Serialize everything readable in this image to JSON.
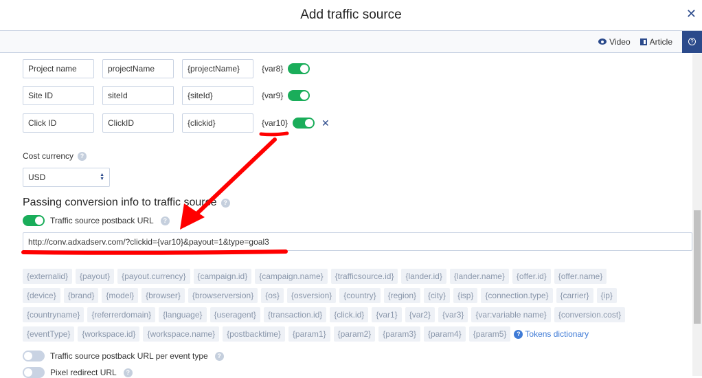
{
  "header": {
    "title": "Add traffic source",
    "close_icon": "close-icon"
  },
  "helpbar": {
    "video": "Video",
    "article": "Article"
  },
  "variables": [
    {
      "name": "Project name",
      "param": "projectName",
      "token": "{projectName}",
      "var": "{var8}",
      "enabled": true
    },
    {
      "name": "Site ID",
      "param": "siteId",
      "token": "{siteId}",
      "var": "{var9}",
      "enabled": true
    },
    {
      "name": "Click ID",
      "param": "ClickID",
      "token": "{clickid}",
      "var": "{var10}",
      "enabled": true
    }
  ],
  "cost_currency": {
    "label": "Cost currency",
    "value": "USD"
  },
  "conversion": {
    "heading": "Passing conversion info to traffic source",
    "postback_label": "Traffic source postback URL",
    "postback_enabled": true,
    "postback_url": "http://conv.adxadserv.com/?clickid={var10}&payout=1&type=goal3",
    "token_rows": [
      [
        "{externalid}",
        "{payout}",
        "{payout.currency}",
        "{campaign.id}",
        "{campaign.name}",
        "{trafficsource.id}",
        "{lander.id}",
        "{lander.name}",
        "{offer.id}",
        "{offer.name}"
      ],
      [
        "{device}",
        "{brand}",
        "{model}",
        "{browser}",
        "{browserversion}",
        "{os}",
        "{osversion}",
        "{country}",
        "{region}",
        "{city}",
        "{isp}",
        "{connection.type}",
        "{carrier}",
        "{ip}"
      ],
      [
        "{countryname}",
        "{referrerdomain}",
        "{language}",
        "{useragent}",
        "{transaction.id}",
        "{click.id}",
        "{var1}",
        "{var2}",
        "{var3}",
        "{var:variable name}",
        "{conversion.cost}"
      ],
      [
        "{eventType}",
        "{workspace.id}",
        "{workspace.name}",
        "{postbacktime}",
        "{param1}",
        "{param2}",
        "{param3}",
        "{param4}",
        "{param5}"
      ]
    ],
    "tokens_dictionary": "Tokens dictionary",
    "per_event_label": "Traffic source postback URL per event type",
    "per_event_enabled": false,
    "pixel_label": "Pixel redirect URL",
    "pixel_enabled": false
  },
  "colors": {
    "accent": "#2b4a8b",
    "toggle_on": "#1aad5a",
    "annotation": "#ff0000"
  }
}
